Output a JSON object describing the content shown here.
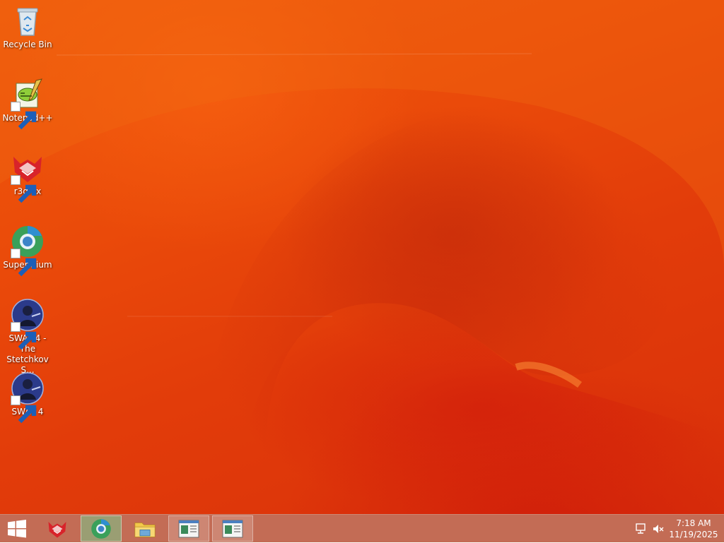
{
  "desktop": {
    "icons": [
      {
        "label": "Recycle Bin",
        "icon": "recycle-bin-icon"
      },
      {
        "label": "Notepad++",
        "icon": "notepad-plus-plus-icon",
        "shortcut": true
      },
      {
        "label": "r3dfox",
        "icon": "r3dfox-icon",
        "shortcut": true
      },
      {
        "label": "Supermium",
        "icon": "supermium-icon",
        "shortcut": true
      },
      {
        "label": "SWAT 4 - The Stetchkov S...",
        "icon": "swat4-expansion-icon",
        "shortcut": true
      },
      {
        "label": "SWAT 4",
        "icon": "swat4-icon",
        "shortcut": true
      }
    ]
  },
  "taskbar": {
    "start": {
      "icon": "windows-logo-icon"
    },
    "pinned": [
      {
        "name": "r3dfox",
        "icon": "r3dfox-icon",
        "state": "pinned"
      },
      {
        "name": "Supermium",
        "icon": "supermium-icon",
        "state": "active"
      },
      {
        "name": "File Explorer",
        "icon": "file-explorer-icon",
        "state": "pinned"
      },
      {
        "name": "Window 1",
        "icon": "app-window-icon",
        "state": "open"
      },
      {
        "name": "Window 2",
        "icon": "app-window-icon",
        "state": "open"
      }
    ],
    "tray": {
      "network_icon": "network-icon",
      "volume_icon": "volume-muted-icon",
      "time": "7:18 AM",
      "date": "11/19/2025"
    }
  },
  "colors": {
    "wallpaper_primary": "#e8480a",
    "wallpaper_dark": "#c8200a",
    "taskbar": "#be5f46",
    "active_task": "#78c88c"
  }
}
